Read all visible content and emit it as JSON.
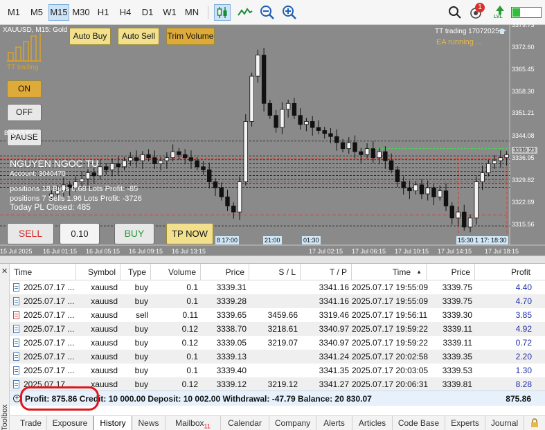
{
  "toolbar": {
    "timeframes": [
      "M1",
      "M5",
      "M15",
      "M30",
      "H1",
      "H4",
      "D1",
      "W1",
      "MN"
    ],
    "active_timeframe": "M15",
    "notification_count": "1",
    "lvl_label": "LVL"
  },
  "chart": {
    "title": "XAUUSD, M15:  Gold",
    "logo_text": "TT trading",
    "tt_header": "TT trading  17072025",
    "ea_status": "EA running ...",
    "buttons": {
      "auto_buy": "Auto Buy",
      "auto_sell": "Auto Sell",
      "trim_volume": "Trim Volume",
      "on": "ON",
      "off": "OFF",
      "pause": "PAUSE",
      "sell": "SELL",
      "volume": "0.10",
      "buy": "BUY",
      "tp_now": "TP NOW"
    },
    "account_name": "NGUYEN NGOC TU",
    "account_number": "Account: 3040470",
    "positions_buy": "positions    18 Buys   0.68 Lots   Profit: -85",
    "positions_sell": "positions    7 Sells   1.96 Lots   Profit: -3726",
    "today_pl": "Today PL Closed:  485",
    "level_label": "B 3343.50",
    "price_labels": [
      "3379.73",
      "3372.60",
      "3365.45",
      "3358.30",
      "3351.21",
      "3344.08",
      "3339.23",
      "3336.95",
      "3329.82",
      "3322.69",
      "3315.56"
    ],
    "current_price": "3339.23",
    "time_labels": [
      "15 Jul 2025",
      "16 Jul 01:15",
      "16 Jul 05:15",
      "16 Jul 09:15",
      "16 Jul 13:15",
      "17 Jul 02:15",
      "17 Jul 06:15",
      "17 Jul 10:15",
      "17 Jul 14:15",
      "17 Jul 18:15"
    ],
    "time_boxes": [
      "8 17:00",
      "21:00",
      "01:30",
      "15:30",
      "1",
      "17:",
      "18:30"
    ]
  },
  "chart_data": {
    "type": "candlestick",
    "y_range": [
      3312,
      3382
    ],
    "close_series": [
      3326,
      3327,
      3329,
      3328,
      3330,
      3331,
      3333,
      3332,
      3335,
      3334,
      3336,
      3335,
      3337,
      3338,
      3337,
      3339,
      3338,
      3336,
      3337,
      3338,
      3340,
      3339,
      3338,
      3337,
      3335,
      3334,
      3330,
      3328,
      3325,
      3322,
      3320,
      3330,
      3350,
      3365,
      3372,
      3356,
      3352,
      3348,
      3354,
      3356,
      3352,
      3349,
      3350,
      3348,
      3347,
      3346,
      3345,
      3343,
      3341,
      3343,
      3340,
      3339,
      3341,
      3338,
      3340,
      3337,
      3334,
      3330,
      3328,
      3327,
      3329,
      3326,
      3328,
      3325,
      3327,
      3322,
      3318,
      3320,
      3315,
      3318,
      3330,
      3333,
      3336,
      3337,
      3338,
      3339
    ],
    "levels": {
      "tp_line_green": 3341.0,
      "red_dashed": [
        3337.7,
        3330.0,
        3319.0
      ],
      "white_dashed": [
        3343.5,
        3338.6,
        3337.3,
        3336.0,
        3334.7,
        3333.4,
        3332.1,
        3330.8,
        3329.4,
        3328.2,
        3315.4
      ]
    }
  },
  "table": {
    "columns": [
      "Time",
      "Symbol",
      "Type",
      "Volume",
      "Price",
      "S / L",
      "T / P",
      "Time",
      "Price",
      "Profit"
    ],
    "rows": [
      [
        "2025.07.17 ...",
        "xauusd",
        "buy",
        "0.1",
        "3339.31",
        "",
        "3341.16",
        "2025.07.17 19:55:09",
        "3339.75",
        "4.40"
      ],
      [
        "2025.07.17 ...",
        "xauusd",
        "buy",
        "0.1",
        "3339.28",
        "",
        "3341.16",
        "2025.07.17 19:55:09",
        "3339.75",
        "4.70"
      ],
      [
        "2025.07.17 ...",
        "xauusd",
        "sell",
        "0.11",
        "3339.65",
        "3459.66",
        "3319.46",
        "2025.07.17 19:56:11",
        "3339.30",
        "3.85"
      ],
      [
        "2025.07.17 ...",
        "xauusd",
        "buy",
        "0.12",
        "3338.70",
        "3218.61",
        "3340.97",
        "2025.07.17 19:59:22",
        "3339.11",
        "4.92"
      ],
      [
        "2025.07.17 ...",
        "xauusd",
        "buy",
        "0.12",
        "3339.05",
        "3219.07",
        "3340.97",
        "2025.07.17 19:59:22",
        "3339.11",
        "0.72"
      ],
      [
        "2025.07.17 ...",
        "xauusd",
        "buy",
        "0.1",
        "3339.13",
        "",
        "3341.24",
        "2025.07.17 20:02:58",
        "3339.35",
        "2.20"
      ],
      [
        "2025.07.17 ...",
        "xauusd",
        "buy",
        "0.1",
        "3339.40",
        "",
        "3341.35",
        "2025.07.17 20:03:05",
        "3339.53",
        "1.30"
      ],
      [
        "2025.07.17 ...",
        "xauusd",
        "buy",
        "0.12",
        "3339.12",
        "3219.12",
        "3341.27",
        "2025.07.17 20:06:31",
        "3339.81",
        "8.28"
      ]
    ],
    "summary": "Profit: 875.86  Credit: 10 000.00  Deposit: 10 002.00  Withdrawal: -47.79  Balance: 20 830.07",
    "summary_total": "875.86"
  },
  "toolbox_label": "Toolbox",
  "tabs": [
    "Trade",
    "Exposure",
    "History",
    "News",
    "Mailbox",
    "Calendar",
    "Company",
    "Alerts",
    "Articles",
    "Code Base",
    "Experts",
    "Journal"
  ],
  "active_tab": "History",
  "mailbox_count": "11",
  "colors": {
    "chart_bg": "#8a8a8a",
    "highlight": "#e0161c",
    "profit_text": "#1f2ea8",
    "accent_yellow": "#f2e08d"
  }
}
